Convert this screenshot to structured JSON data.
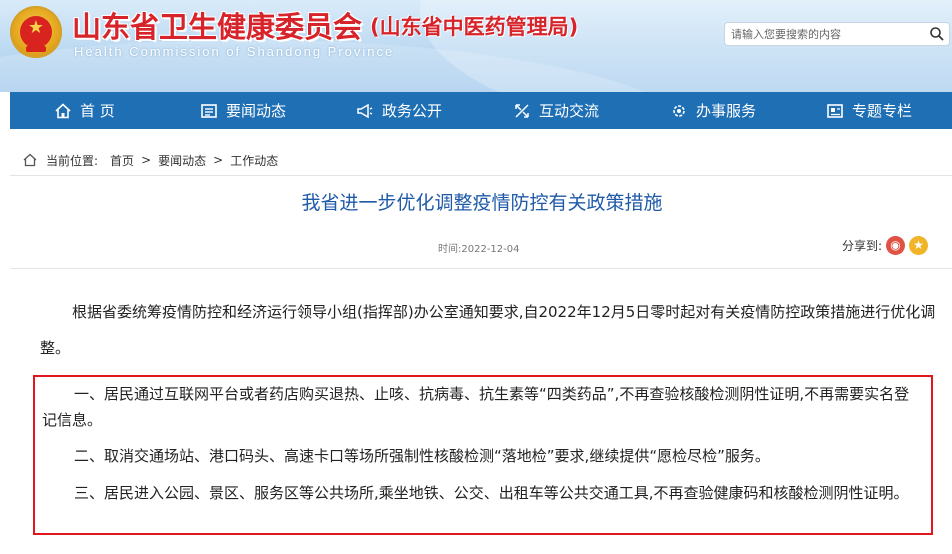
{
  "header": {
    "title": "山东省卫生健康委员会",
    "subtitle": "(山东省中医药管理局)",
    "english": "Health Commission of Shandong Province",
    "emblem_glyph": "★",
    "search_placeholder": "请输入您要搜索的内容"
  },
  "nav": {
    "items": [
      {
        "label": "首 页",
        "icon": "home-icon"
      },
      {
        "label": "要闻动态",
        "icon": "news-icon"
      },
      {
        "label": "政务公开",
        "icon": "megaphone-icon"
      },
      {
        "label": "互动交流",
        "icon": "interact-icon"
      },
      {
        "label": "办事服务",
        "icon": "service-gear-icon"
      },
      {
        "label": "专题专栏",
        "icon": "topic-icon"
      }
    ]
  },
  "breadcrumb": {
    "label": "当前位置:",
    "items": [
      "首页",
      "要闻动态",
      "工作动态"
    ],
    "separator": ">"
  },
  "article": {
    "title": "我省进一步优化调整疫情防控有关政策措施",
    "time": "时间:2022-12-04",
    "share_label": "分享到:",
    "share_icons": [
      "weibo-icon",
      "favorite-star-icon"
    ],
    "intro": "根据省委统筹疫情防控和经济运行领导小组(指挥部)办公室通知要求,自2022年12月5日零时起对有关疫情防控政策措施进行优化调整。",
    "points": [
      "一、居民通过互联网平台或者药店购买退热、止咳、抗病毒、抗生素等“四类药品”,不再查验核酸检测阴性证明,不再需要实名登记信息。",
      "二、取消交通场站、港口码头、高速卡口等场所强制性核酸检测“落地检”要求,继续提供“愿检尽检”服务。",
      "三、居民进入公园、景区、服务区等公共场所,乘坐地铁、公交、出租车等公共交通工具,不再查验健康码和核酸检测阴性证明。"
    ]
  },
  "colors": {
    "nav_bg": "#1f6fb5",
    "title_red": "#d6242a",
    "article_title_blue": "#1f5aa8",
    "highlight_border": "#e0171d"
  }
}
